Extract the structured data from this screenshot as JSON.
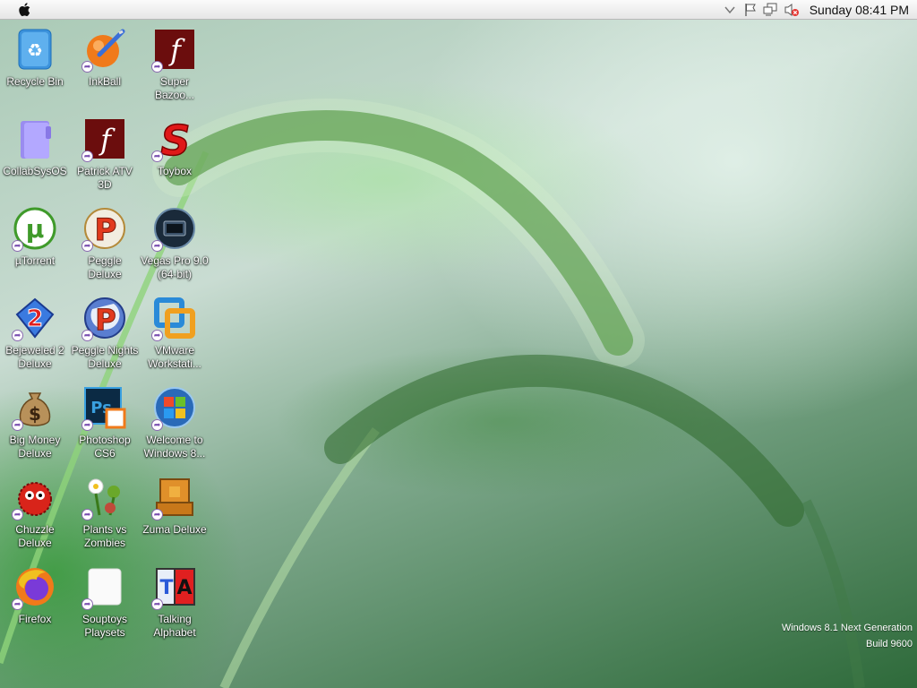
{
  "menubar": {
    "clock": "Sunday 08:41 PM",
    "tray_icons": [
      "chevron-down-icon",
      "flag-icon",
      "network-icon",
      "volume-muted-icon"
    ]
  },
  "desktop": {
    "icons": [
      {
        "label": "Recycle Bin",
        "icon": "recycle-bin-icon"
      },
      {
        "label": "InkBall",
        "icon": "inkball-icon"
      },
      {
        "label": "Super\nBazoo...",
        "icon": "flash-icon"
      },
      {
        "label": "CollabSysOS",
        "icon": "folder-icon"
      },
      {
        "label": "Patrick ATV\n3D",
        "icon": "flash-icon"
      },
      {
        "label": "Toybox",
        "icon": "toybox-icon"
      },
      {
        "label": "µTorrent",
        "icon": "utorrent-icon"
      },
      {
        "label": "Peggle Deluxe",
        "icon": "peggle-icon"
      },
      {
        "label": "Vegas Pro 9.0\n(64-bit)",
        "icon": "vegas-icon"
      },
      {
        "label": "Bejeweled 2\nDeluxe",
        "icon": "bejeweled-icon"
      },
      {
        "label": "Peggle Nights\nDeluxe",
        "icon": "peggle-nights-icon"
      },
      {
        "label": "VMware\nWorkstati...",
        "icon": "vmware-icon"
      },
      {
        "label": "Big Money\nDeluxe",
        "icon": "money-bag-icon"
      },
      {
        "label": "Photoshop\nCS6",
        "icon": "photoshop-icon"
      },
      {
        "label": "Welcome to\nWindows 8...",
        "icon": "windows-icon"
      },
      {
        "label": "Chuzzle\nDeluxe",
        "icon": "chuzzle-icon"
      },
      {
        "label": "Plants vs\nZombies",
        "icon": "plants-icon"
      },
      {
        "label": "Zuma Deluxe",
        "icon": "zuma-icon"
      },
      {
        "label": "Firefox",
        "icon": "firefox-icon"
      },
      {
        "label": "Souptoys\nPlaysets",
        "icon": "blank-icon"
      },
      {
        "label": "Talking\nAlphabet",
        "icon": "talking-alphabet-icon"
      }
    ]
  },
  "watermark": {
    "line1": "Windows 8.1 Next Generation",
    "line2": "Build 9600"
  }
}
